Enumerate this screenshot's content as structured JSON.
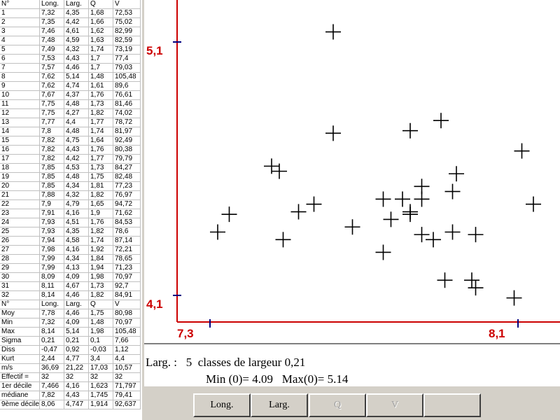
{
  "table": {
    "headers": [
      "N°",
      "Long.",
      "Larg.",
      "Q",
      "V"
    ],
    "rows": [
      [
        "1",
        "7,32",
        "4,35",
        "1,68",
        "72,53"
      ],
      [
        "2",
        "7,35",
        "4,42",
        "1,66",
        "75,02"
      ],
      [
        "3",
        "7,46",
        "4,61",
        "1,62",
        "82,99"
      ],
      [
        "4",
        "7,48",
        "4,59",
        "1,63",
        "82,59"
      ],
      [
        "5",
        "7,49",
        "4,32",
        "1,74",
        "73,19"
      ],
      [
        "6",
        "7,53",
        "4,43",
        "1,7",
        "77,4"
      ],
      [
        "7",
        "7,57",
        "4,46",
        "1,7",
        "79,03"
      ],
      [
        "8",
        "7,62",
        "5,14",
        "1,48",
        "105,48"
      ],
      [
        "9",
        "7,62",
        "4,74",
        "1,61",
        "89,6"
      ],
      [
        "10",
        "7,67",
        "4,37",
        "1,76",
        "76,61"
      ],
      [
        "11",
        "7,75",
        "4,48",
        "1,73",
        "81,46"
      ],
      [
        "12",
        "7,75",
        "4,27",
        "1,82",
        "74,02"
      ],
      [
        "13",
        "7,77",
        "4,4",
        "1,77",
        "78,72"
      ],
      [
        "14",
        "7,8",
        "4,48",
        "1,74",
        "81,97"
      ],
      [
        "15",
        "7,82",
        "4,75",
        "1,64",
        "92,49"
      ],
      [
        "16",
        "7,82",
        "4,43",
        "1,76",
        "80,38"
      ],
      [
        "17",
        "7,82",
        "4,42",
        "1,77",
        "79,79"
      ],
      [
        "18",
        "7,85",
        "4,53",
        "1,73",
        "84,27"
      ],
      [
        "19",
        "7,85",
        "4,48",
        "1,75",
        "82,48"
      ],
      [
        "20",
        "7,85",
        "4,34",
        "1,81",
        "77,23"
      ],
      [
        "21",
        "7,88",
        "4,32",
        "1,82",
        "76,97"
      ],
      [
        "22",
        "7,9",
        "4,79",
        "1,65",
        "94,72"
      ],
      [
        "23",
        "7,91",
        "4,16",
        "1,9",
        "71,62"
      ],
      [
        "24",
        "7,93",
        "4,51",
        "1,76",
        "84,53"
      ],
      [
        "25",
        "7,93",
        "4,35",
        "1,82",
        "78,6"
      ],
      [
        "26",
        "7,94",
        "4,58",
        "1,74",
        "87,14"
      ],
      [
        "27",
        "7,98",
        "4,16",
        "1,92",
        "72,21"
      ],
      [
        "28",
        "7,99",
        "4,34",
        "1,84",
        "78,65"
      ],
      [
        "29",
        "7,99",
        "4,13",
        "1,94",
        "71,23"
      ],
      [
        "30",
        "8,09",
        "4,09",
        "1,98",
        "70,97"
      ],
      [
        "31",
        "8,11",
        "4,67",
        "1,73",
        "92,7"
      ],
      [
        "32",
        "8,14",
        "4,46",
        "1,82",
        "84,91"
      ]
    ],
    "stats_headers": [
      "N°",
      "Long.",
      "Larg.",
      "Q",
      "V"
    ],
    "stats_rows": [
      [
        "Moy",
        "7,78",
        "4,46",
        "1,75",
        "80,98"
      ],
      [
        "Min",
        "7,32",
        "4,09",
        "1,48",
        "70,97"
      ],
      [
        "Max",
        "8,14",
        "5,14",
        "1,98",
        "105,48"
      ],
      [
        "Sigma",
        "0,21",
        "0,21",
        "0,1",
        "7,66"
      ],
      [
        "Diss",
        "-0,47",
        "0,92",
        "-0,03",
        "1,12"
      ],
      [
        "Kurt",
        "2,44",
        "4,77",
        "3,4",
        "4,4"
      ],
      [
        "m/s",
        "36,69",
        "21,22",
        "17,03",
        "10,57"
      ],
      [
        "Effectif =",
        "32",
        "32",
        "32",
        "32"
      ],
      [
        "1er décile",
        "7,466",
        "4,16",
        "1,623",
        "71,797"
      ],
      [
        "médiane",
        "7,82",
        "4,43",
        "1,745",
        "79,41"
      ],
      [
        "9ème décile",
        "8,06",
        "4,747",
        "1,914",
        "92,637"
      ]
    ]
  },
  "chart_data": {
    "type": "scatter",
    "x_tick_labels": [
      "7,3",
      "8,1"
    ],
    "y_tick_labels": [
      "5,1",
      "4,1"
    ],
    "xlim": [
      7.3,
      8.1
    ],
    "ylim": [
      4.1,
      5.1
    ],
    "marker": "plus",
    "marker_color": "#000000",
    "axis_color": "#cc0000",
    "x": [
      7.32,
      7.35,
      7.46,
      7.48,
      7.49,
      7.53,
      7.57,
      7.62,
      7.62,
      7.67,
      7.75,
      7.75,
      7.77,
      7.8,
      7.82,
      7.82,
      7.82,
      7.85,
      7.85,
      7.85,
      7.88,
      7.9,
      7.91,
      7.93,
      7.93,
      7.94,
      7.98,
      7.99,
      7.99,
      8.09,
      8.11,
      8.14
    ],
    "y": [
      4.35,
      4.42,
      4.61,
      4.59,
      4.32,
      4.43,
      4.46,
      5.14,
      4.74,
      4.37,
      4.48,
      4.27,
      4.4,
      4.48,
      4.75,
      4.43,
      4.42,
      4.53,
      4.48,
      4.34,
      4.32,
      4.79,
      4.16,
      4.51,
      4.35,
      4.58,
      4.16,
      4.34,
      4.13,
      4.09,
      4.67,
      4.46
    ]
  },
  "info": {
    "label": "Larg. :",
    "classes_count": "5",
    "classes_text": "classes de largeur",
    "classes_width": "0,21",
    "min_text": "Min (0)= 4.09",
    "max_text": "Max(0)= 5.14"
  },
  "buttons": {
    "long_label": "Long.",
    "larg_label": "Larg.",
    "q_label": "Q",
    "v_label": "V",
    "empty_label": ""
  }
}
